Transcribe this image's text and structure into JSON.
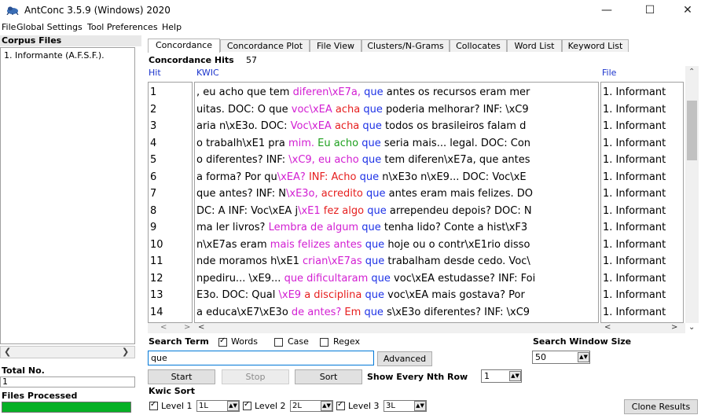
{
  "window": {
    "title": "AntConc 3.5.9 (Windows) 2020",
    "minimize_glyph": "—",
    "maximize_glyph": "☐",
    "close_glyph": "✕"
  },
  "menu": [
    "File",
    "Global Settings",
    "Tool Preferences",
    "Help"
  ],
  "left_panel": {
    "corpus_files_label": "Corpus Files",
    "files": [
      "1. Informante (A.F.S.F.)."
    ],
    "total_no_label": "Total No.",
    "total_no_value": "1",
    "files_processed_label": "Files Processed",
    "progress": 1.0
  },
  "tabs": [
    "Concordance",
    "Concordance Plot",
    "File View",
    "Clusters/N-Grams",
    "Collocates",
    "Word List",
    "Keyword List"
  ],
  "concordance": {
    "hits_label": "Concordance Hits",
    "hits_value": "57",
    "columns": {
      "hit": "Hit",
      "kwic": "KWIC",
      "file": "File"
    },
    "rows": [
      {
        "hit": "1",
        "segments": [
          {
            "t": ", eu acho que tem ",
            "c": ""
          },
          {
            "t": "diferen\\xE7a,",
            "c": "magenta"
          },
          {
            "t": " ",
            "c": ""
          },
          {
            "t": "que",
            "c": "blue"
          },
          {
            "t": " antes os recursos eram mer",
            "c": ""
          }
        ],
        "file": "1. Informant"
      },
      {
        "hit": "2",
        "segments": [
          {
            "t": "uitas. DOC: O que ",
            "c": ""
          },
          {
            "t": "voc\\xEA",
            "c": "magenta"
          },
          {
            "t": " ",
            "c": ""
          },
          {
            "t": "acha",
            "c": "red"
          },
          {
            "t": " ",
            "c": ""
          },
          {
            "t": "que",
            "c": "blue"
          },
          {
            "t": " poderia melhorar? INF: \\xC9",
            "c": ""
          }
        ],
        "file": "1. Informant"
      },
      {
        "hit": "3",
        "segments": [
          {
            "t": "aria n\\xE3o. DOC: ",
            "c": ""
          },
          {
            "t": "Voc\\xEA",
            "c": "magenta"
          },
          {
            "t": " ",
            "c": ""
          },
          {
            "t": "acha",
            "c": "red"
          },
          {
            "t": " ",
            "c": ""
          },
          {
            "t": "que",
            "c": "blue"
          },
          {
            "t": " todos os brasileiros falam d",
            "c": ""
          }
        ],
        "file": "1. Informant"
      },
      {
        "hit": "4",
        "segments": [
          {
            "t": "o trabalh\\xE1 pra ",
            "c": ""
          },
          {
            "t": "mim.",
            "c": "magenta"
          },
          {
            "t": " ",
            "c": ""
          },
          {
            "t": "Eu acho",
            "c": "green"
          },
          {
            "t": " ",
            "c": ""
          },
          {
            "t": "que",
            "c": "blue"
          },
          {
            "t": " seria mais... legal. DOC: Con",
            "c": ""
          }
        ],
        "file": "1. Informant"
      },
      {
        "hit": "5",
        "segments": [
          {
            "t": "o diferentes? INF: ",
            "c": ""
          },
          {
            "t": "\\xC9,",
            "c": "magenta"
          },
          {
            "t": " ",
            "c": ""
          },
          {
            "t": "eu acho",
            "c": "magenta"
          },
          {
            "t": " ",
            "c": ""
          },
          {
            "t": "que",
            "c": "blue"
          },
          {
            "t": " tem diferen\\xE7a, que antes",
            "c": ""
          }
        ],
        "file": "1. Informant"
      },
      {
        "hit": "6",
        "segments": [
          {
            "t": "a forma? Por qu",
            "c": ""
          },
          {
            "t": "\\xEA?",
            "c": "magenta"
          },
          {
            "t": " ",
            "c": ""
          },
          {
            "t": "INF: Acho",
            "c": "red"
          },
          {
            "t": " ",
            "c": ""
          },
          {
            "t": "que",
            "c": "blue"
          },
          {
            "t": " n\\xE3o n\\xE9... DOC: Voc\\xE",
            "c": ""
          }
        ],
        "file": "1. Informant"
      },
      {
        "hit": "7",
        "segments": [
          {
            "t": "que antes? INF: N",
            "c": ""
          },
          {
            "t": "\\xE3o,",
            "c": "magenta"
          },
          {
            "t": " ",
            "c": ""
          },
          {
            "t": "acredito",
            "c": "red"
          },
          {
            "t": " ",
            "c": ""
          },
          {
            "t": "que",
            "c": "blue"
          },
          {
            "t": " antes eram mais felizes. DO",
            "c": ""
          }
        ],
        "file": "1. Informant"
      },
      {
        "hit": "8",
        "segments": [
          {
            "t": "DC: A INF: Voc\\xEA j",
            "c": ""
          },
          {
            "t": "\\xE1",
            "c": "magenta"
          },
          {
            "t": " ",
            "c": ""
          },
          {
            "t": "fez algo",
            "c": "red"
          },
          {
            "t": " ",
            "c": ""
          },
          {
            "t": "que",
            "c": "blue"
          },
          {
            "t": " arrependeu depois? DOC: N",
            "c": ""
          }
        ],
        "file": "1. Informant"
      },
      {
        "hit": "9",
        "segments": [
          {
            "t": "ma ler livros? ",
            "c": ""
          },
          {
            "t": "Lembra",
            "c": "magenta"
          },
          {
            "t": " ",
            "c": ""
          },
          {
            "t": "de algum",
            "c": "magenta"
          },
          {
            "t": " ",
            "c": ""
          },
          {
            "t": "que",
            "c": "blue"
          },
          {
            "t": " tenha lido? Conte a hist\\xF3",
            "c": ""
          }
        ],
        "file": "1. Informant"
      },
      {
        "hit": "10",
        "segments": [
          {
            "t": "n\\xE7as eram ",
            "c": ""
          },
          {
            "t": "mais felizes",
            "c": "magenta"
          },
          {
            "t": " ",
            "c": ""
          },
          {
            "t": "antes",
            "c": "magenta"
          },
          {
            "t": " ",
            "c": ""
          },
          {
            "t": "que",
            "c": "blue"
          },
          {
            "t": " hoje ou o contr\\xE1rio disso",
            "c": ""
          }
        ],
        "file": "1. Informant"
      },
      {
        "hit": "11",
        "segments": [
          {
            "t": "nde moramos h\\xE1 ",
            "c": ""
          },
          {
            "t": "crian\\xE7as",
            "c": "magenta"
          },
          {
            "t": " ",
            "c": ""
          },
          {
            "t": "que",
            "c": "blue"
          },
          {
            "t": " trabalham desde cedo. Voc\\",
            "c": ""
          }
        ],
        "file": "1. Informant"
      },
      {
        "hit": "12",
        "segments": [
          {
            "t": "npediru... \\xE9... ",
            "c": ""
          },
          {
            "t": "que dificultaram",
            "c": "magenta"
          },
          {
            "t": " ",
            "c": ""
          },
          {
            "t": "que",
            "c": "blue"
          },
          {
            "t": " voc\\xEA estudasse? INF: Foi",
            "c": ""
          }
        ],
        "file": "1. Informant"
      },
      {
        "hit": "13",
        "segments": [
          {
            "t": "E3o. DOC: Qual ",
            "c": ""
          },
          {
            "t": "\\xE9",
            "c": "magenta"
          },
          {
            "t": " ",
            "c": ""
          },
          {
            "t": "a disciplina",
            "c": "red"
          },
          {
            "t": " ",
            "c": ""
          },
          {
            "t": "que",
            "c": "blue"
          },
          {
            "t": " voc\\xEA mais gostava? Por",
            "c": ""
          }
        ],
        "file": "1. Informant"
      },
      {
        "hit": "14",
        "segments": [
          {
            "t": "a educa\\xE7\\xE3o ",
            "c": ""
          },
          {
            "t": "de antes?",
            "c": "magenta"
          },
          {
            "t": " ",
            "c": ""
          },
          {
            "t": "Em",
            "c": "red"
          },
          {
            "t": " ",
            "c": ""
          },
          {
            "t": "que",
            "c": "blue"
          },
          {
            "t": " s\\xE3o diferentes? INF: \\xC9",
            "c": ""
          }
        ],
        "file": "1. Informant"
      }
    ]
  },
  "controls": {
    "search_term_label": "Search Term",
    "words_label": "Words",
    "case_label": "Case",
    "regex_label": "Regex",
    "words_checked": true,
    "case_checked": false,
    "regex_checked": false,
    "search_value": "que",
    "advanced_label": "Advanced",
    "search_window_label": "Search Window Size",
    "search_window_value": "50",
    "start_label": "Start",
    "stop_label": "Stop",
    "sort_label": "Sort",
    "nth_row_label": "Show Every Nth Row",
    "nth_row_value": "1",
    "kwic_sort_label": "Kwic Sort",
    "level1_label": "Level 1",
    "level1_value": "1L",
    "level2_label": "Level 2",
    "level2_value": "2L",
    "level3_label": "Level 3",
    "level3_value": "3L",
    "clone_label": "Clone Results"
  },
  "colors": {
    "blue": "#1e32e6",
    "magenta": "#d21ed2",
    "red": "#e61e1e",
    "green": "#1ea01e",
    "progress": "#06b025"
  }
}
